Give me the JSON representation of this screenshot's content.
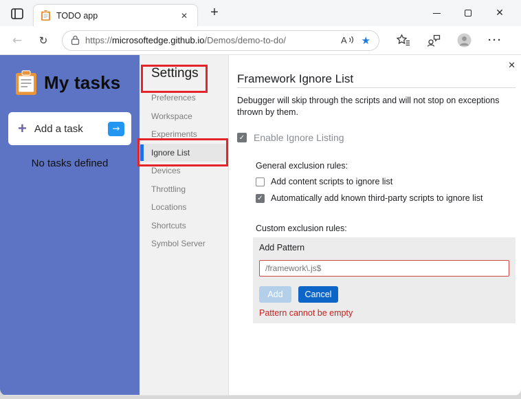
{
  "browser": {
    "tab_title": "TODO app",
    "url": {
      "scheme": "https://",
      "host": "microsoftedge.github.io",
      "path": "/Demos/demo-to-do/"
    },
    "read_aloud_label": "A",
    "glyphs": {
      "close": "✕",
      "plus": "+",
      "back": "←",
      "refresh": "↻",
      "star": "★",
      "ellipsis": "···",
      "arrow_right": "→",
      "check": "✓"
    }
  },
  "todo": {
    "title": "My tasks",
    "add_task_label": "Add a task",
    "empty_state": "No tasks defined"
  },
  "settings": {
    "heading": "Settings",
    "items": [
      {
        "label": "Preferences",
        "selected": false
      },
      {
        "label": "Workspace",
        "selected": false
      },
      {
        "label": "Experiments",
        "selected": false
      },
      {
        "label": "Ignore List",
        "selected": true
      },
      {
        "label": "Devices",
        "selected": false
      },
      {
        "label": "Throttling",
        "selected": false
      },
      {
        "label": "Locations",
        "selected": false
      },
      {
        "label": "Shortcuts",
        "selected": false
      },
      {
        "label": "Symbol Server",
        "selected": false
      }
    ]
  },
  "panel": {
    "title": "Framework Ignore List",
    "description": "Debugger will skip through the scripts and will not stop on exceptions thrown by them.",
    "enable_checkbox": {
      "label": "Enable Ignore Listing",
      "checked": true
    },
    "general_rules_label": "General exclusion rules:",
    "rules": [
      {
        "label": "Add content scripts to ignore list",
        "checked": false
      },
      {
        "label": "Automatically add known third-party scripts to ignore list",
        "checked": true
      }
    ],
    "custom_rules_label": "Custom exclusion rules:",
    "add_pattern": {
      "label": "Add Pattern",
      "placeholder": "/framework\\.js$",
      "add_button": "Add",
      "cancel_button": "Cancel",
      "error": "Pattern cannot be empty"
    }
  },
  "colors": {
    "sidebar_purple": "#5d74c4",
    "annotation_red": "#e3252b",
    "accent_blue": "#1a73e8",
    "cancel_blue": "#0d65c8",
    "add_disabled_blue": "#b3cfea",
    "error_red": "#c5221f",
    "bookmark_star_blue": "#1f7ae0"
  }
}
